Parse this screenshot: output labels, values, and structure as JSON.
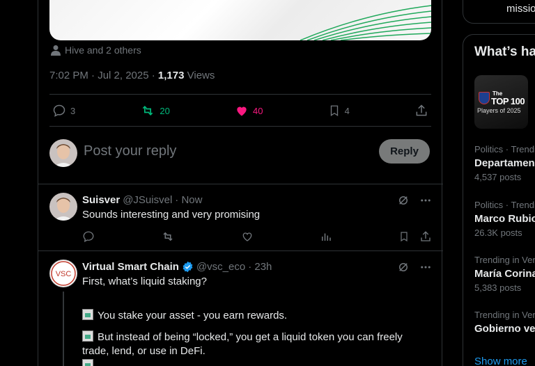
{
  "tweet": {
    "tagged_text": "Hive and 2 others",
    "time": "7:02 PM · Jul 2, 2025 · ",
    "views_count": "1,173",
    "views_label": " Views",
    "reply_count": "3",
    "retweet_count": "20",
    "like_count": "40",
    "bookmark_count": "4"
  },
  "reply_box": {
    "placeholder": "Post your reply",
    "button_label": "Reply"
  },
  "replies": [
    {
      "name": "Suisver",
      "handle": "@JSuisvel",
      "time": "· Now",
      "text": "Sounds interesting and very promising"
    },
    {
      "name": "Virtual Smart Chain",
      "handle": "@vsc_eco",
      "time": "· 23h",
      "avatar_text": "VSC",
      "text_lines": [
        "First, what’s liquid staking?",
        "You stake your asset - you earn rewards.",
        "But instead of being “locked,” you get a liquid token you can freely",
        "trade, lend, or use in DeFi."
      ]
    }
  ],
  "sidebar": {
    "top_text": "missio",
    "title": "What’s ha",
    "promo": {
      "line1": "The",
      "line2": "TOP 100",
      "line3": "Players of 2025"
    },
    "trends": [
      {
        "context": "Politics · Trendi",
        "name": "Departamen",
        "count": "4,537 posts"
      },
      {
        "context": "Politics · Trendi",
        "name": "Marco Rubio",
        "count": "26.3K posts"
      },
      {
        "context": "Trending in Ven",
        "name": "María Corina",
        "count": "5,383 posts"
      },
      {
        "context": "Trending in Ven",
        "name": "Gobierno ve",
        "count": ""
      }
    ],
    "show_more": "Show more"
  },
  "colors": {
    "accent_blue": "#1d9bf0",
    "retweet_green": "#00ba7c",
    "like_pink": "#f91880",
    "border": "#2f3336"
  }
}
